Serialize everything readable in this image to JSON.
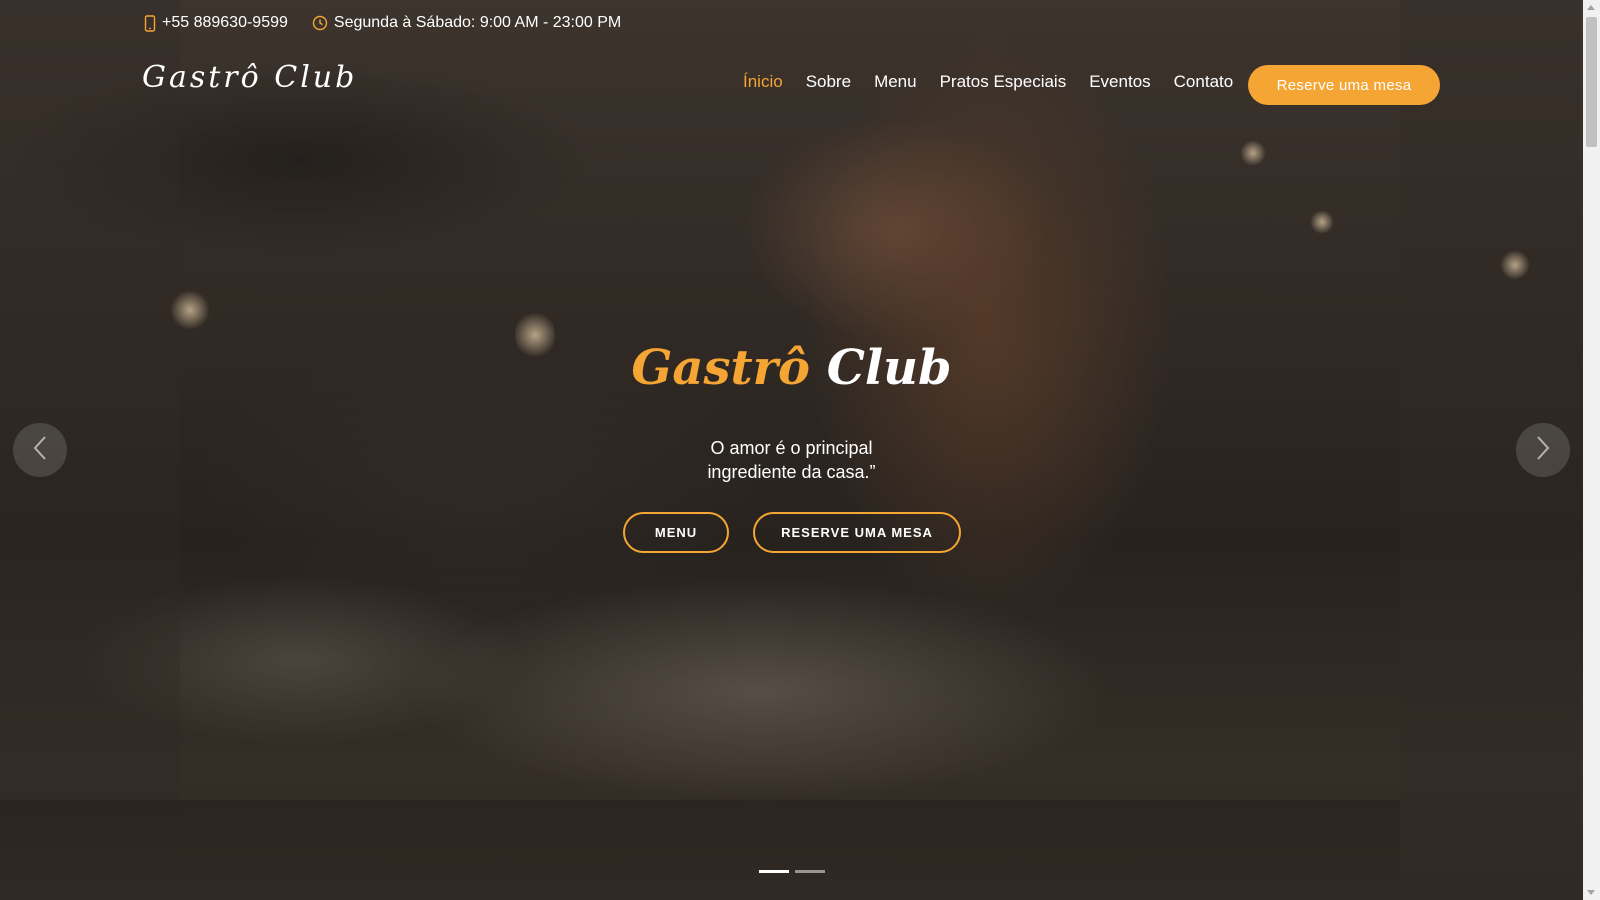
{
  "topbar": {
    "phone": "+55 889630-9599",
    "hours": "Segunda à Sábado: 9:00 AM - 23:00 PM",
    "phone_icon": "mobile-phone-icon",
    "hours_icon": "clock-icon"
  },
  "header": {
    "logo": "Gastrô Club",
    "nav": [
      {
        "label": "Ínicio",
        "active": true
      },
      {
        "label": "Sobre"
      },
      {
        "label": "Menu"
      },
      {
        "label": "Pratos Especiais"
      },
      {
        "label": "Eventos"
      },
      {
        "label": "Contato"
      }
    ],
    "reserve_label": "Reserve uma mesa"
  },
  "hero": {
    "title_part1": "Gastrô",
    "title_part2": "Club",
    "subtitle_line1": "O amor é o principal",
    "subtitle_line2": "ingrediente da casa.”",
    "menu_button": "MENU",
    "reserve_button": "RESERVE UMA MESA"
  },
  "carousel": {
    "prev_icon": "chevron-left-icon",
    "next_icon": "chevron-right-icon",
    "slides": 2,
    "active_slide": 1
  },
  "colors": {
    "accent": "#f5a533",
    "text": "#ffffff"
  }
}
